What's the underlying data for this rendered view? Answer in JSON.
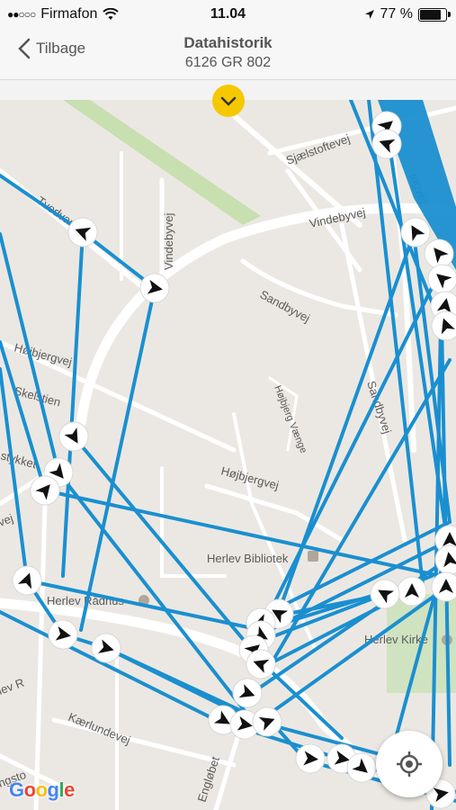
{
  "status_bar": {
    "carrier": "Firmafon",
    "time": "11.04",
    "battery_percent": "77 %",
    "battery_level": 0.77
  },
  "header": {
    "back_label": "Tilbage",
    "title": "Datahistorik",
    "subtitle": "6126 GR 802"
  },
  "map": {
    "street_labels": [
      "Sjælstoftevej",
      "Vindebyvej",
      "Tvedvangen",
      "Vindebyvej",
      "Sandbyvej",
      "Højbjergvej",
      "Skelstien",
      "Højbjerg Vænge",
      "Sandbyvej",
      "stykket",
      "Højbjergvej",
      "vej",
      "Kærlundevej",
      "Engløbet",
      "ngsto",
      "ingvej",
      "lev R"
    ],
    "places": [
      "Herlev Bibliotek",
      "Herlev Rådhus",
      "Herlev Kirke"
    ],
    "route_color": "#1a8fd0",
    "marker_count": 40
  },
  "icons": {
    "back": "chevron-left-icon",
    "pull": "chevron-down-icon",
    "locate": "crosshair-icon",
    "marker": "direction-arrow-icon"
  },
  "attribution": "Google"
}
